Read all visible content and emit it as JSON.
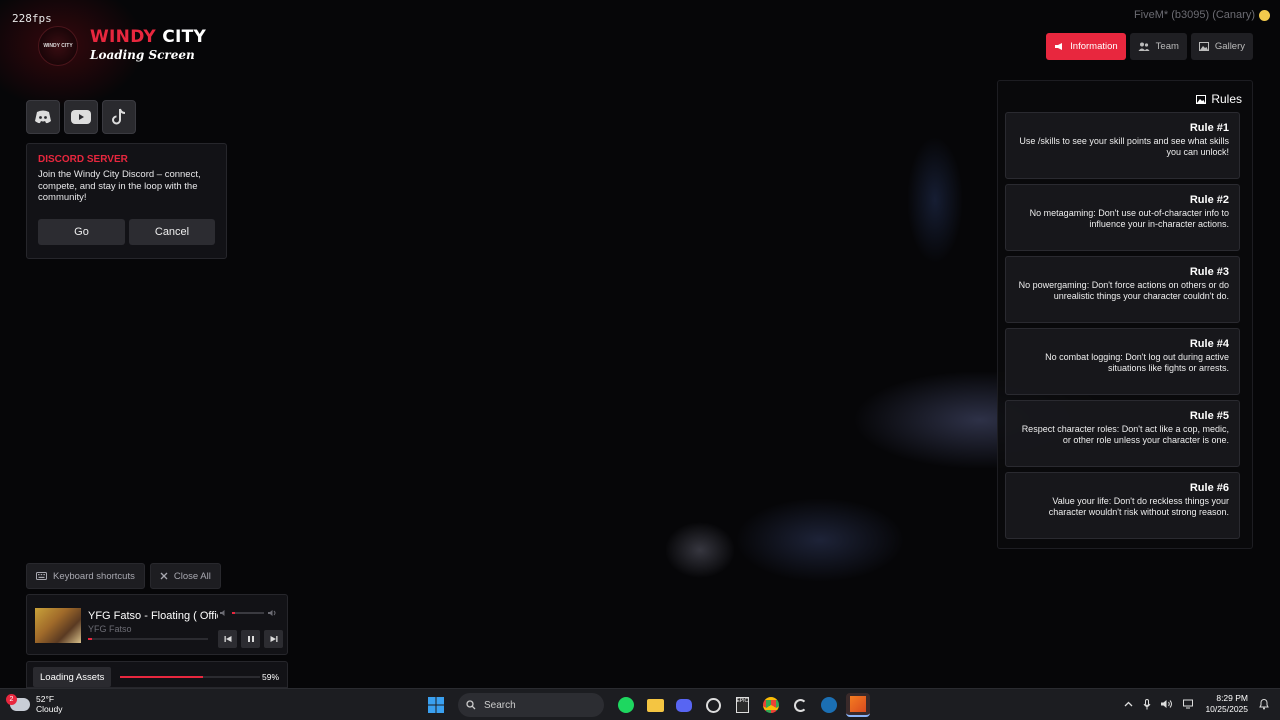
{
  "overlay": {
    "fps": "228fps",
    "client_info": "FiveM* (b3095) (Canary)"
  },
  "brand": {
    "logo_text": "WINDY CITY",
    "title_part1": "WINDY",
    "title_part2": "CITY",
    "subtitle": "Loading Screen"
  },
  "socials": [
    "discord-icon",
    "youtube-icon",
    "tiktok-icon"
  ],
  "discord_card": {
    "heading": "DISCORD SERVER",
    "body": "Join the Windy City Discord – connect, compete, and stay in the loop with the community!",
    "go_label": "Go",
    "cancel_label": "Cancel"
  },
  "nav": {
    "information": "Information",
    "team": "Team",
    "gallery": "Gallery"
  },
  "rules": {
    "title": "Rules",
    "items": [
      {
        "label": "Rule #1",
        "text": "Use /skills to see your skill points and see what skills you can unlock!"
      },
      {
        "label": "Rule #2",
        "text": "No metagaming: Don't use out-of-character info to influence your in-character actions."
      },
      {
        "label": "Rule #3",
        "text": "No powergaming: Don't force actions on others or do unrealistic things your character couldn't do."
      },
      {
        "label": "Rule #4",
        "text": "No combat logging: Don't log out during active situations like fights or arrests."
      },
      {
        "label": "Rule #5",
        "text": "Respect character roles: Don't act like a cop, medic, or other role unless your character is one."
      },
      {
        "label": "Rule #6",
        "text": "Value your life: Don't do reckless things your character wouldn't risk without strong reason."
      }
    ]
  },
  "controls": {
    "keyboard_shortcuts": "Keyboard shortcuts",
    "close_all": "Close All"
  },
  "player": {
    "song": "YFG Fatso - Floating ( Official",
    "artist": "YFG Fatso",
    "progress": 0.03,
    "volume": 0.1
  },
  "loading": {
    "label": "Loading Assets",
    "percent_text": "59%",
    "progress": 0.59
  },
  "taskbar": {
    "weather_badge": "2",
    "temperature": "52°F",
    "condition": "Cloudy",
    "search_label": "Search",
    "time": "8:29 PM",
    "date": "10/25/2025"
  },
  "colors": {
    "accent": "#e8273e",
    "panel": "#141418"
  }
}
